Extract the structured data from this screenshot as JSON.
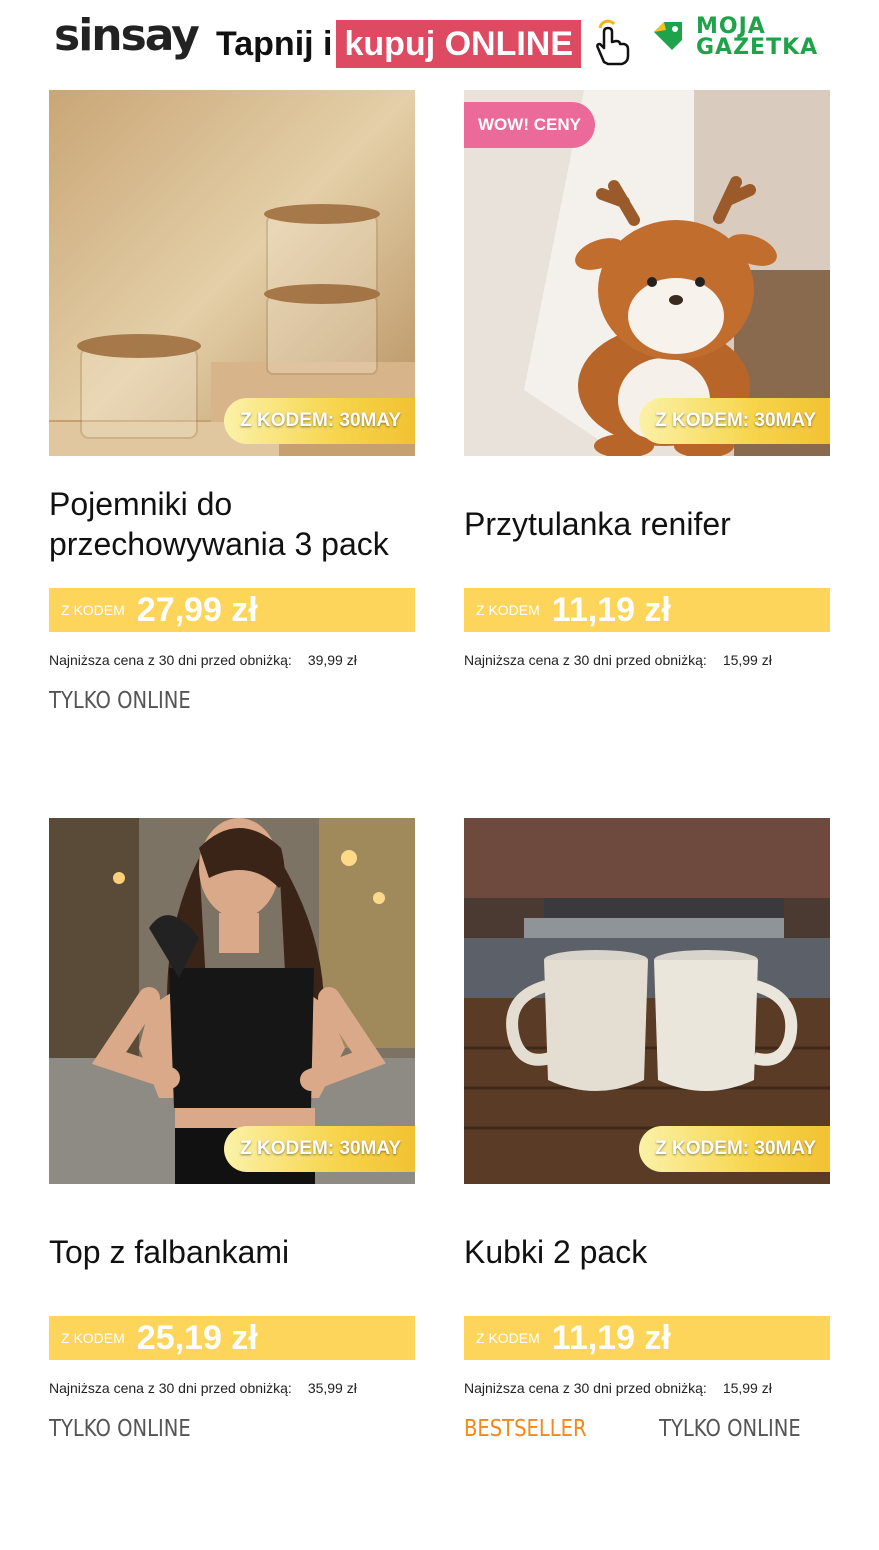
{
  "header": {
    "logo": "sinsay",
    "tagline_prefix": "Tapnij i",
    "tagline_highlight": "kupuj ONLINE",
    "gazetka_line1": "MOJA",
    "gazetka_line2": "GAZETKA"
  },
  "products": [
    {
      "title": "Pojemniki do przechowywania 3 pack",
      "code_badge": "Z KODEM: 30MAY",
      "price_label": "Z KODEM",
      "price": "27,99 zł",
      "lowest_label": "Najniższa cena z 30 dni przed obniżką:",
      "lowest_value": "39,99 zł",
      "tag": "TYLKO ONLINE"
    },
    {
      "title": "Przytulanka renifer",
      "badge": "WOW! CENY",
      "code_badge": "Z KODEM: 30MAY",
      "price_label": "Z KODEM",
      "price": "11,19 zł",
      "lowest_label": "Najniższa cena z 30 dni przed obniżką:",
      "lowest_value": "15,99 zł"
    },
    {
      "title": "Top z falbankami",
      "code_badge": "Z KODEM: 30MAY",
      "price_label": "Z KODEM",
      "price": "25,19 zł",
      "lowest_label": "Najniższa cena z 30 dni przed obniżką:",
      "lowest_value": "35,99 zł",
      "tag": "TYLKO ONLINE"
    },
    {
      "title": "Kubki 2 pack",
      "code_badge": "Z KODEM: 30MAY",
      "price_label": "Z KODEM",
      "price": "11,19 zł",
      "lowest_label": "Najniższa cena z 30 dni przed obniżką:",
      "lowest_value": "15,99 zł",
      "tag_bestseller": "BESTSELLER",
      "tag": "TYLKO ONLINE"
    }
  ],
  "colors": {
    "highlight": "#dd4a62",
    "price_bar": "#fdd55a",
    "wow_badge": "#ec6a9a",
    "bestseller": "#f08a1c",
    "gazetka": "#1ea34a"
  }
}
